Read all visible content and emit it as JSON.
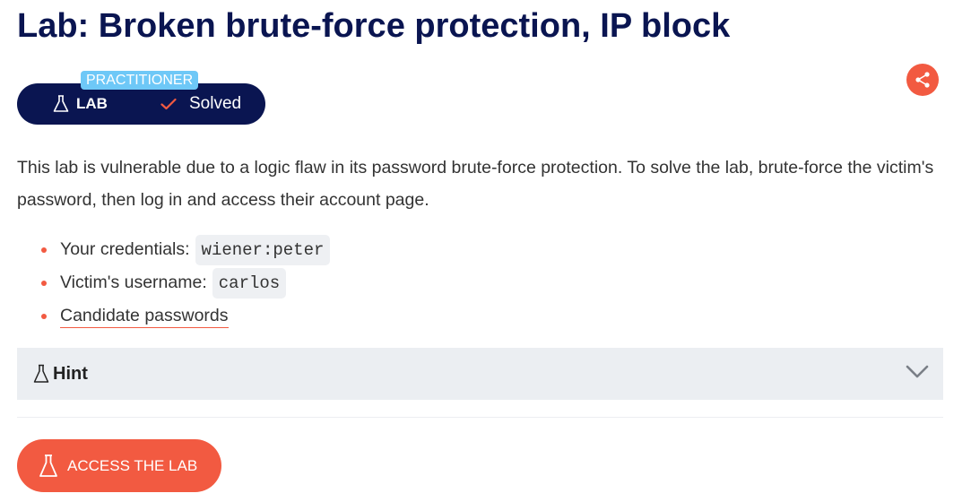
{
  "header": {
    "title": "Lab: Broken brute-force protection, IP block"
  },
  "badge": {
    "level": "PRACTITIONER",
    "lab_label": "LAB",
    "status": "Solved",
    "status_icon": "check-icon",
    "lab_icon": "flask-icon"
  },
  "share": {
    "icon": "share-icon"
  },
  "description": {
    "text": "This lab is vulnerable due to a logic flaw in its password brute-force protection. To solve the lab, brute-force the victim's password, then log in and access their account page."
  },
  "details": {
    "credentials_label": "Your credentials:",
    "credentials_value": "wiener:peter",
    "victim_label": "Victim's username:",
    "victim_value": "carlos",
    "passwords_link": "Candidate passwords"
  },
  "hint": {
    "label": "Hint",
    "icon": "flask-icon",
    "chevron": "chevron-down-icon"
  },
  "action": {
    "access_label": "ACCESS THE LAB"
  },
  "colors": {
    "navy": "#0a1551",
    "accent": "#f25a41",
    "level_tag": "#6ec8f7",
    "hint_bg": "#ebeef2"
  }
}
